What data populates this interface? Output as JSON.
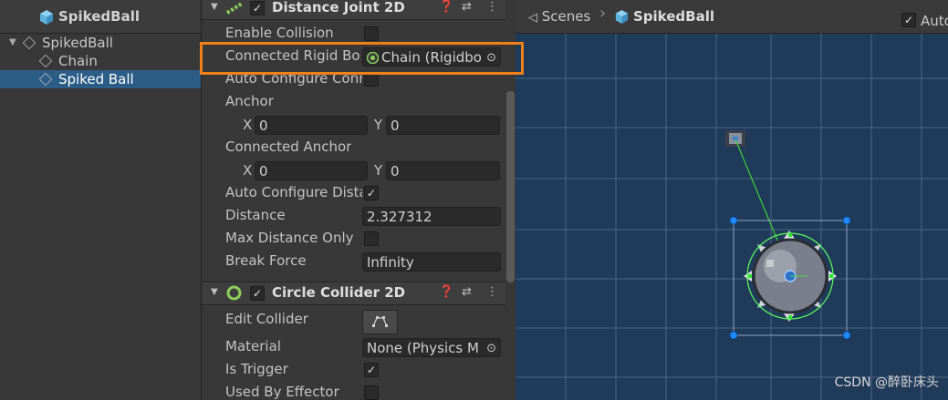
{
  "hierarchy": {
    "title": "SpikedBall",
    "items": [
      {
        "label": "SpikedBall"
      },
      {
        "label": "Chain"
      },
      {
        "label": "Spiked Ball"
      }
    ]
  },
  "inspector": {
    "distance_joint": {
      "title": "Distance Joint 2D",
      "enable_collision": "Enable Collision",
      "connected_rigidbody_label": "Connected Rigid Bo",
      "connected_rigidbody_value": "Chain (Rigidbo",
      "auto_configure_connected": "Auto Configure Conn",
      "anchor": "Anchor",
      "anchor_x": "0",
      "anchor_y": "0",
      "connected_anchor": "Connected Anchor",
      "connected_anchor_x": "0",
      "connected_anchor_y": "0",
      "x_label": "X",
      "y_label": "Y",
      "auto_configure_distance": "Auto Configure Dista",
      "distance_label": "Distance",
      "distance_value": "2.327312",
      "max_distance_only": "Max Distance Only",
      "break_force_label": "Break Force",
      "break_force_value": "Infinity"
    },
    "circle_collider": {
      "title": "Circle Collider 2D",
      "edit_collider": "Edit Collider",
      "material_label": "Material",
      "material_value": "None (Physics M",
      "is_trigger": "Is Trigger",
      "used_by_effector": "Used By Effector"
    }
  },
  "scene": {
    "tab_scenes": "Scenes",
    "tab_object": "SpikedBall",
    "auto_label": "Auto"
  },
  "watermark": "CSDN @醉卧床头",
  "colors": {
    "highlight": "#f08019",
    "selection": "#2c5d87",
    "scene_bg": "#203a5a"
  }
}
